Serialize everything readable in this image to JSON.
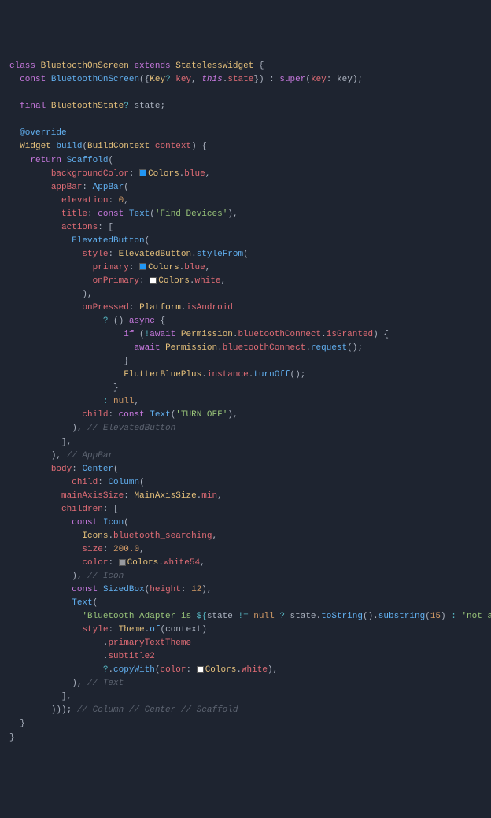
{
  "code": {
    "class_name": "BluetoothOnScreen",
    "extends": "StatelessWidget",
    "constructor": "const BluetoothOnScreen({Key? key, this.state}) : super(key: key);",
    "field": "final BluetoothState? state;",
    "annotation": "@override",
    "method_sig": "Widget build(BuildContext context) {",
    "scaffold": {
      "backgroundColor": "Colors.blue",
      "appBar": {
        "elevation": "0",
        "title_text": "Find Devices",
        "button_style_primary": "Colors.blue",
        "button_style_onPrimary": "Colors.white",
        "onPressed_condition": "Platform.isAndroid",
        "permission_check": "!await Permission.bluetoothConnect.isGranted",
        "permission_request": "await Permission.bluetoothConnect.request();",
        "turnoff": "FlutterBluePlus.instance.turnOff();",
        "child_text": "TURN OFF"
      },
      "body": {
        "mainAxisSize": "MainAxisSize.min",
        "icon": "Icons.bluetooth_searching",
        "icon_size": "200.0",
        "icon_color": "Colors.white54",
        "sizedbox_height": "12",
        "text_template": "'Bluetooth Adapter is ${state != null ? state.toString().substring(15) : 'not available'}.'",
        "style_color": "Colors.white"
      }
    },
    "comments": {
      "elevated_button": "// ElevatedButton",
      "appbar": "// AppBar",
      "icon": "// Icon",
      "text": "// Text",
      "closing": "// Column // Center // Scaffold"
    }
  }
}
